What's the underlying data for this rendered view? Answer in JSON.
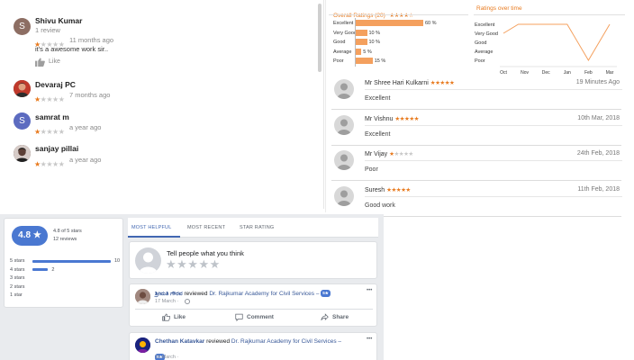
{
  "google_reviews": {
    "items": [
      {
        "name": "Shivu Kumar",
        "sub": "1 review",
        "stars": "★",
        "stars_off": "★★★★",
        "time": "11 months ago",
        "text": "it's a awesome work sir..",
        "like_label": "Like",
        "avatar_letter": "S",
        "avatar_color": "#8d6e63"
      },
      {
        "name": "Devaraj PC",
        "stars": "★",
        "stars_off": "★★★★",
        "time": "7 months ago"
      },
      {
        "name": "samrat m",
        "stars": "★",
        "stars_off": "★★★★",
        "time": "a year ago",
        "avatar_letter": "S",
        "avatar_color": "#5c6bc0"
      },
      {
        "name": "sanjay pillai",
        "stars": "★",
        "stars_off": "★★★★",
        "time": "a year ago"
      }
    ]
  },
  "ratings_panel": {
    "overall_title": "Overall Ratings (20)",
    "overall_stars": "★★★★☆",
    "over_time_title": "Ratings over time",
    "bars": [
      {
        "label": "Excellent",
        "value": 60,
        "text": "60 %"
      },
      {
        "label": "Very Good",
        "value": 10,
        "text": "10 %"
      },
      {
        "label": "Good",
        "value": 10,
        "text": "10 %"
      },
      {
        "label": "Average",
        "value": 5,
        "text": "5 %"
      },
      {
        "label": "Poor",
        "value": 15,
        "text": "15 %"
      }
    ],
    "chart_data": {
      "type": "line",
      "title": "Ratings over time",
      "categories": [
        "Oct",
        "Nov",
        "Dec",
        "Jan",
        "Feb",
        "Mar"
      ],
      "y_categories": [
        "Excellent",
        "Very Good",
        "Good",
        "Average",
        "Poor"
      ],
      "values": [
        "Very Good",
        "Excellent",
        "Excellent",
        "Excellent",
        "Excellent",
        "Poor",
        "Excellent"
      ],
      "x_positions": [
        0,
        0.7,
        1,
        2,
        3,
        4,
        5
      ],
      "color": "#f4a05e"
    },
    "reviews": [
      {
        "name": "Mr Shree Hari Kulkarni",
        "stars_on": "★★★★★",
        "stars_off": "",
        "date": "19 Minutes Ago",
        "text": "Excellent"
      },
      {
        "name": "Mr Vishnu",
        "stars_on": "★★★★★",
        "stars_off": "",
        "date": "10th Mar, 2018",
        "text": "Excellent"
      },
      {
        "name": "Mr Vijay",
        "stars_on": "★",
        "stars_off": "★★★★",
        "date": "24th Feb, 2018",
        "text": "Poor"
      },
      {
        "name": "Suresh",
        "stars_on": "★★★★★",
        "stars_off": "",
        "date": "11th Feb, 2018",
        "text": "Good work"
      }
    ]
  },
  "facebook": {
    "score": "4.8 ★",
    "score_caption": "4.8 of 5 stars",
    "reviews_count": "12 reviews",
    "breakdown": [
      {
        "label": "5 stars",
        "count": "10",
        "value": 10
      },
      {
        "label": "4 stars",
        "count": "2",
        "value": 2
      },
      {
        "label": "3 stars",
        "count": "",
        "value": 0
      },
      {
        "label": "2 stars",
        "count": "",
        "value": 0
      },
      {
        "label": "1 star",
        "count": "",
        "value": 0
      }
    ],
    "tabs": [
      "MOST HELPFUL",
      "MOST RECENT",
      "STAR RATING"
    ],
    "prompt": "Tell people what you think",
    "prompt_stars": "★★★★★",
    "posts": [
      {
        "author": "ಶ್ರೀಮತಿ ಗೌರವ",
        "verb": "reviewed",
        "page": "Dr. Rajkumar Academy for Civil Services –",
        "badge": "5★",
        "date": "17 March ·",
        "more": "•••"
      },
      {
        "author": "Chethan Katavkar",
        "verb": "reviewed",
        "page": "Dr. Rajkumar Academy for Civil Services –",
        "badge": "5★",
        "date": "15 March ·",
        "more": "•••"
      }
    ],
    "actions": [
      "Like",
      "Comment",
      "Share"
    ]
  }
}
